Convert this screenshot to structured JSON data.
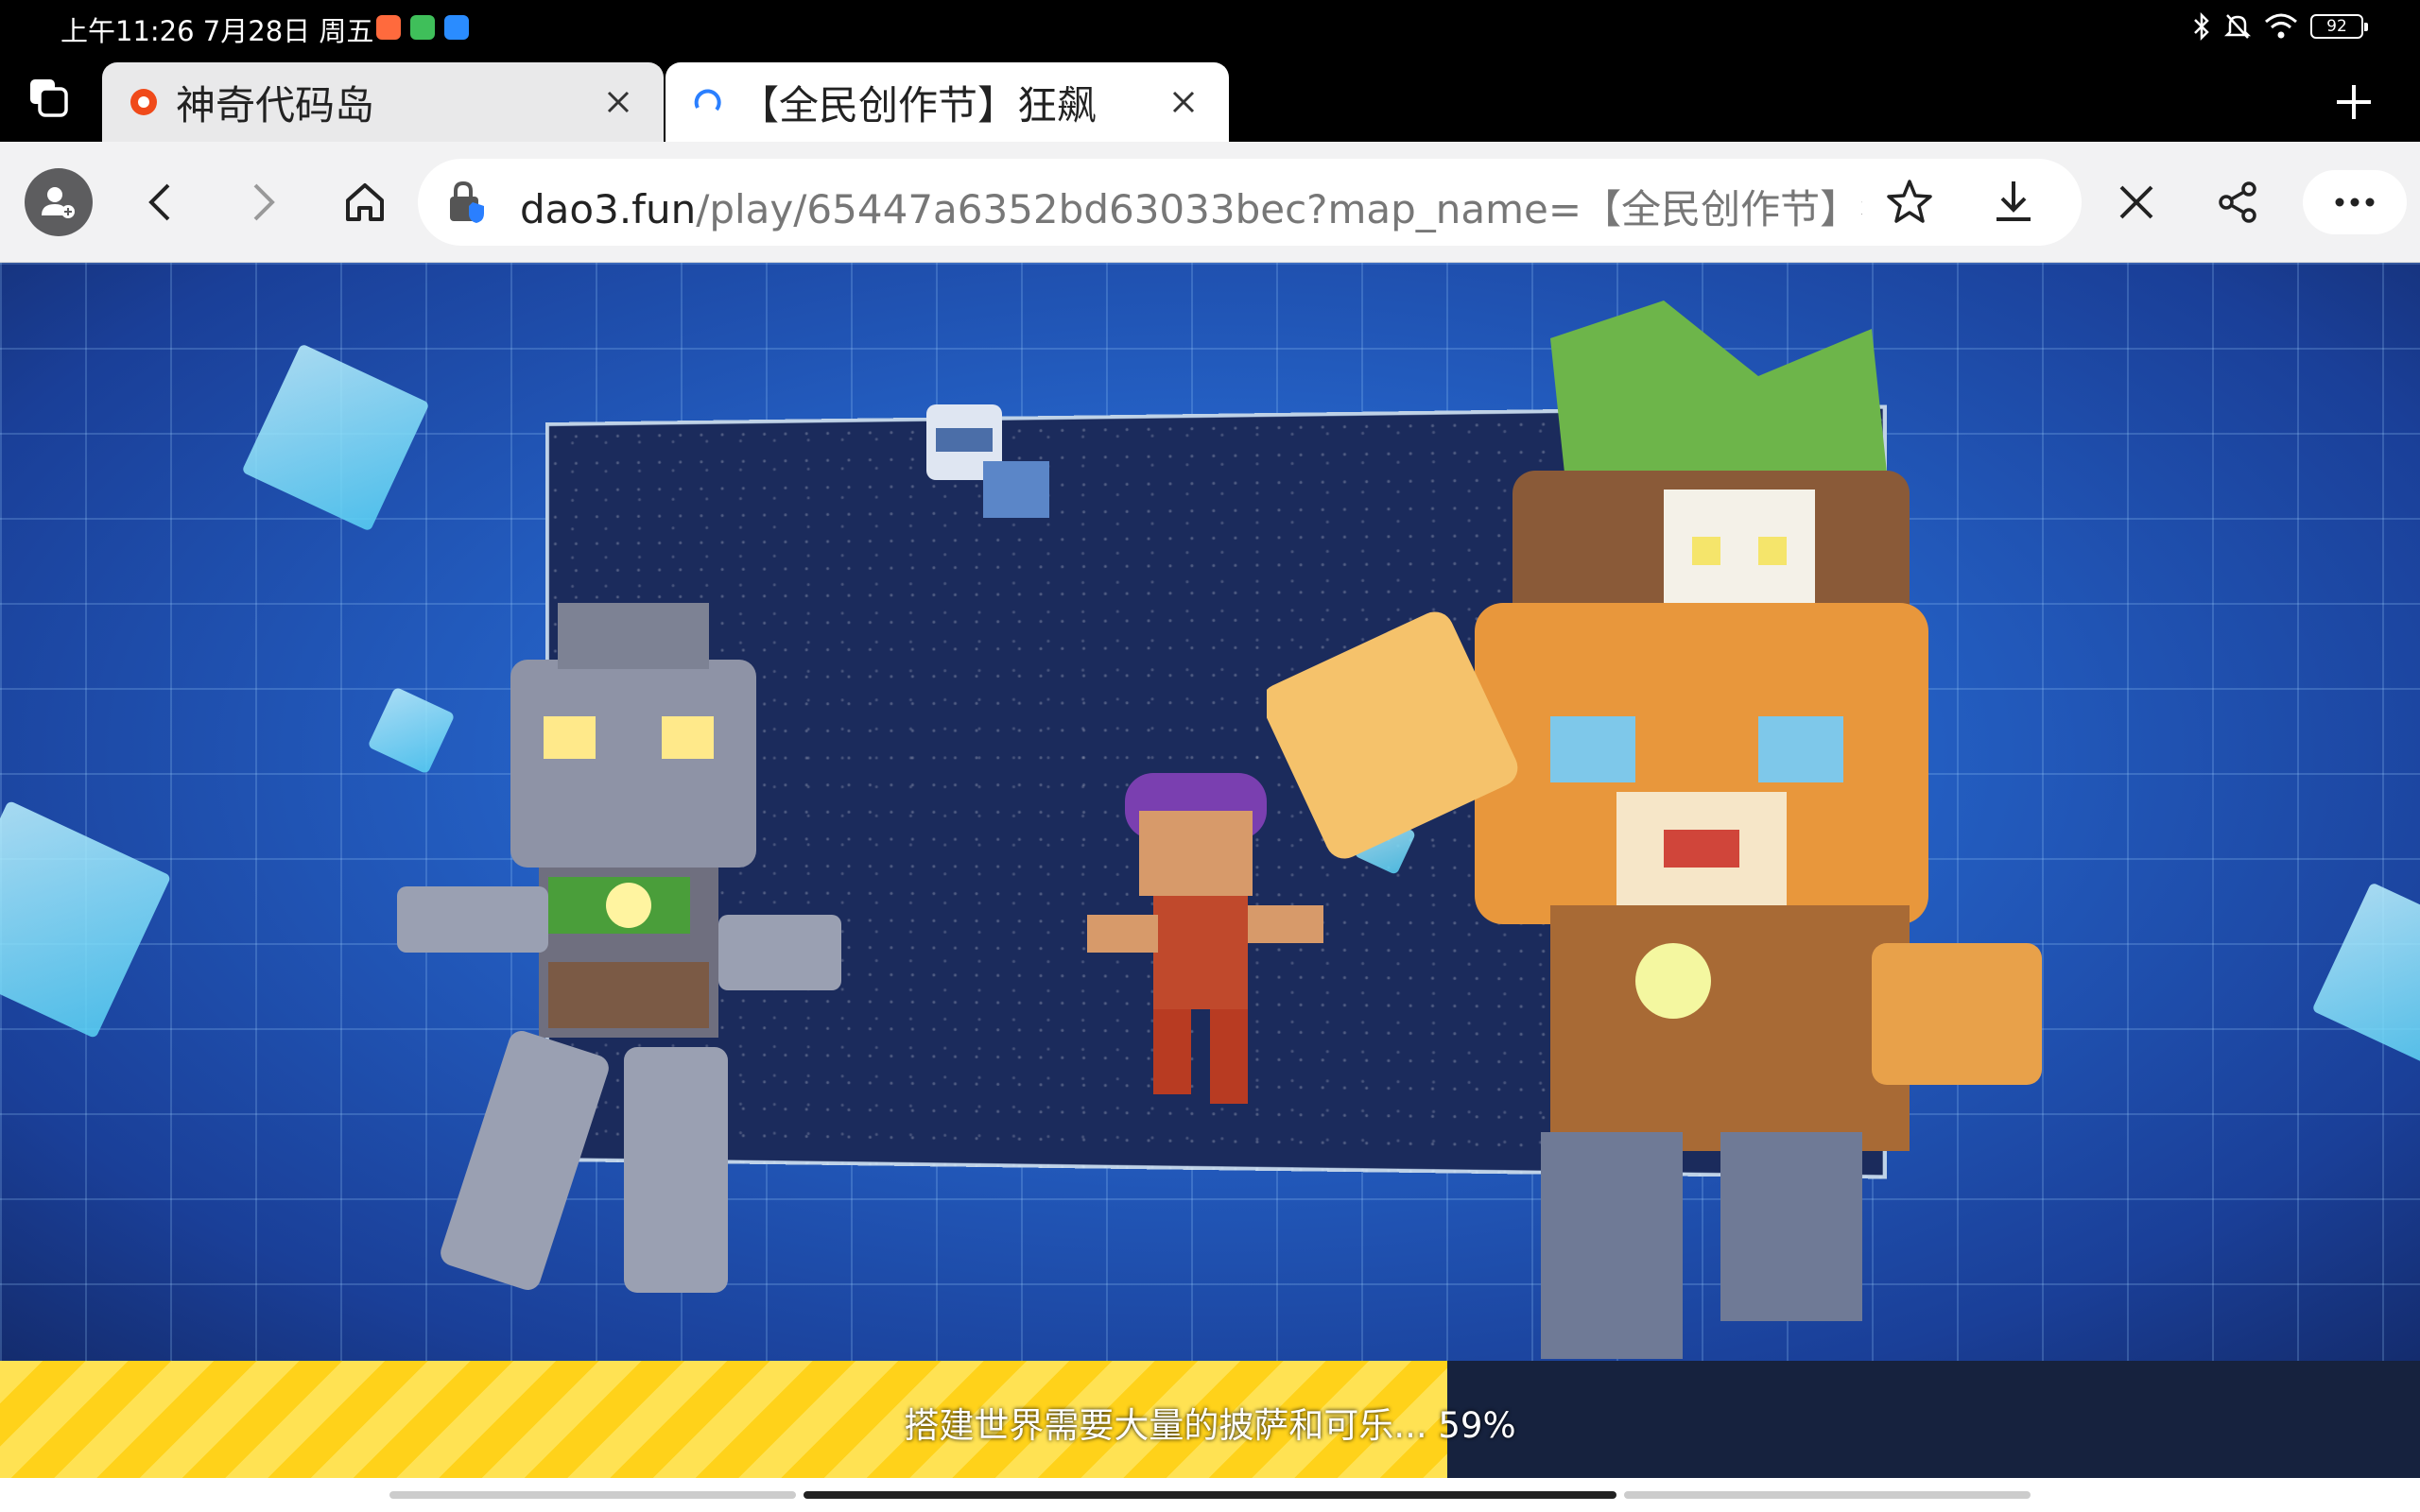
{
  "status_bar": {
    "time": "上午11:26 7月28日 周五",
    "battery": "92",
    "app_colors": [
      "#ff6a3d",
      "#3fbf5a",
      "#2a8cff"
    ]
  },
  "tabs": [
    {
      "title": "神奇代码岛",
      "active": false
    },
    {
      "title": "【全民创作节】狂飙",
      "active": true
    }
  ],
  "toolbar": {
    "url_domain": "dao3.fun",
    "url_path": "/play/65447a6352bd63033bec?map_name=【全民创作节】狂飙"
  },
  "game": {
    "loading_text": "搭建世界需要大量的披萨和可乐... 59%",
    "progress": 0.598
  },
  "colors": {
    "loading_fill": "#ffd21a",
    "loading_track": "#16223e",
    "toolbar_bg": "#f2f2f3"
  }
}
